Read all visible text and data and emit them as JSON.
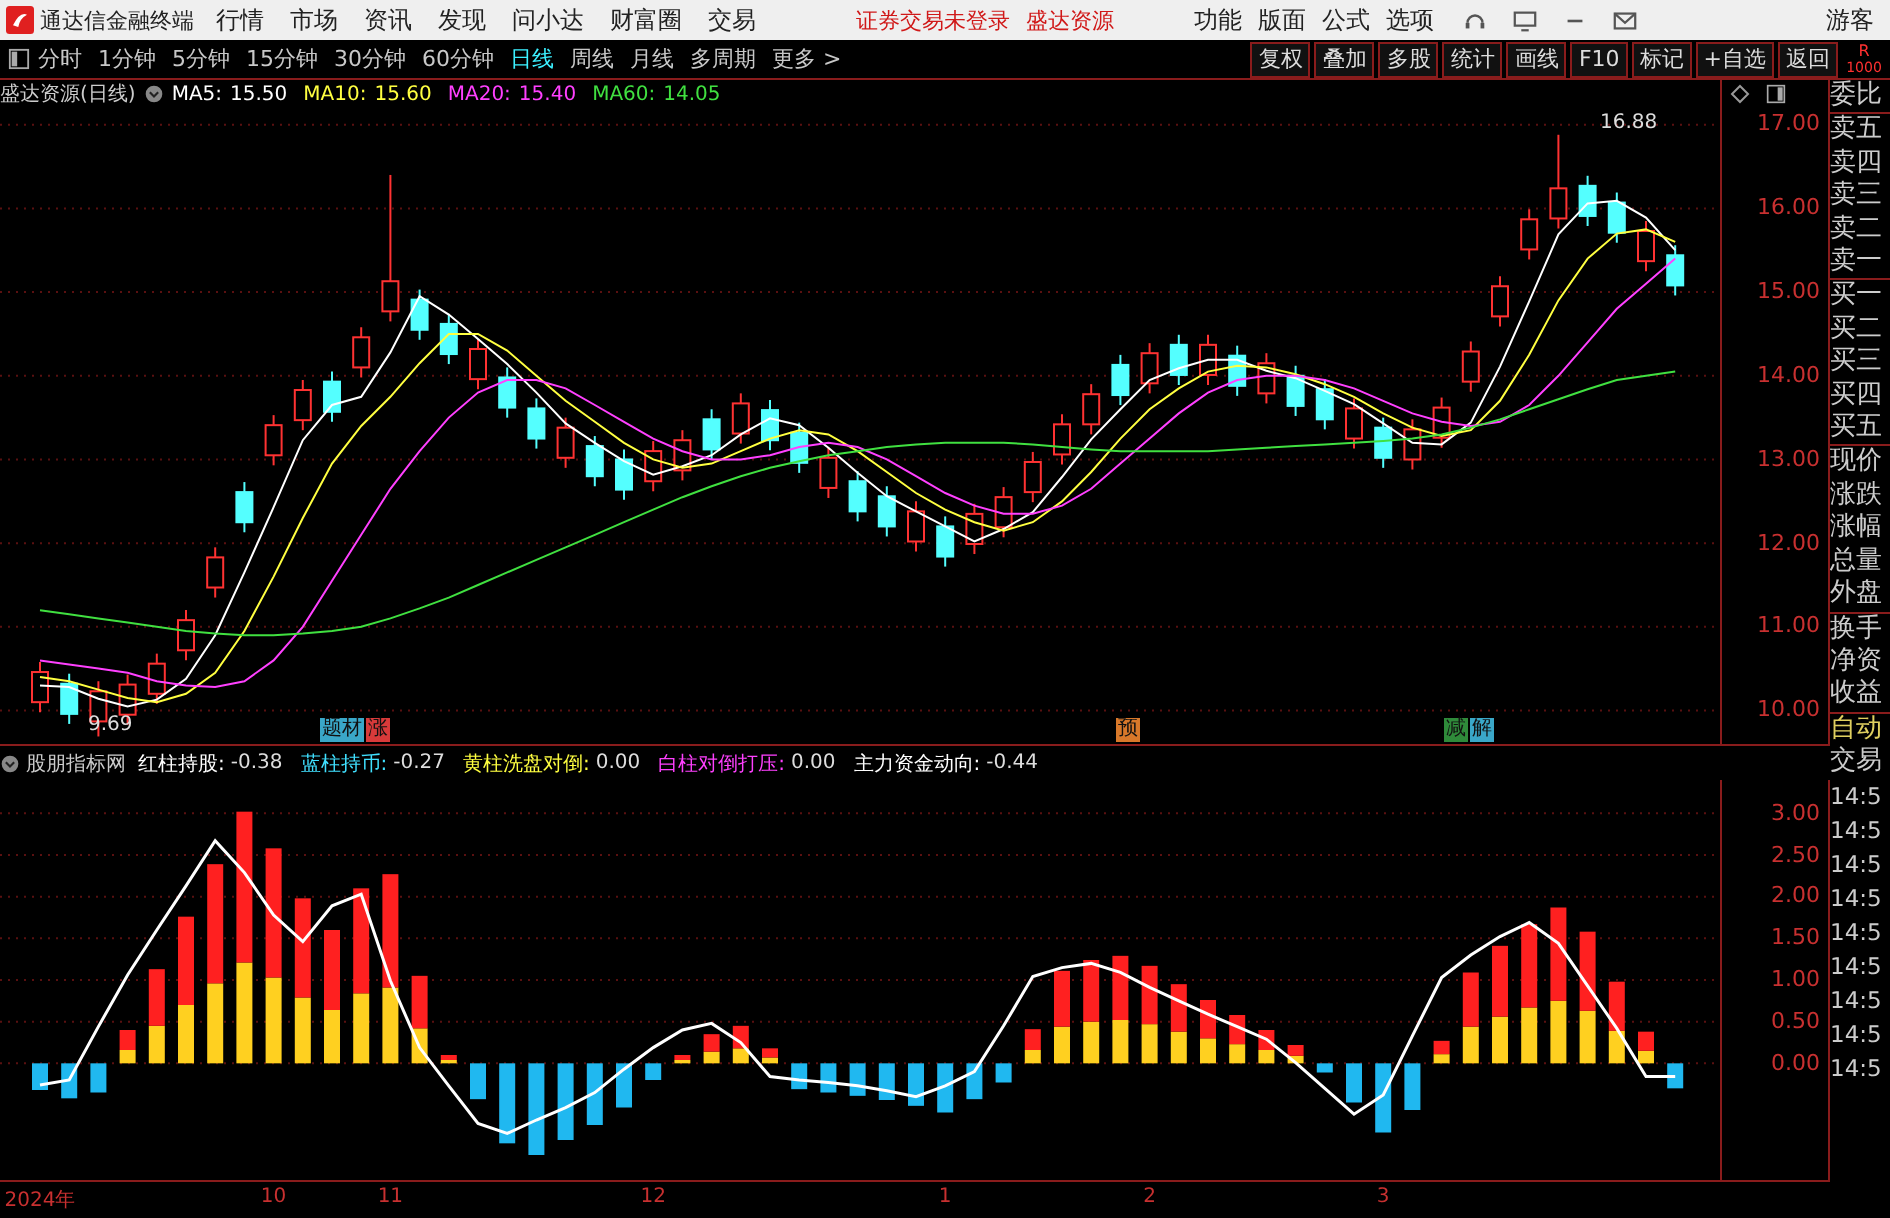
{
  "top_bar": {
    "app_title": "通达信金融终端",
    "menu": [
      "行情",
      "市场",
      "资讯",
      "发现",
      "问小达",
      "财富圈",
      "交易"
    ],
    "status": [
      "证券交易未登录",
      "盛达资源"
    ],
    "right_menu": [
      "功能",
      "版面",
      "公式",
      "选项"
    ],
    "user": "游客"
  },
  "toolbar": {
    "periods": [
      {
        "label": "分时",
        "selected": false
      },
      {
        "label": "1分钟",
        "selected": false
      },
      {
        "label": "5分钟",
        "selected": false
      },
      {
        "label": "15分钟",
        "selected": false
      },
      {
        "label": "30分钟",
        "selected": false
      },
      {
        "label": "60分钟",
        "selected": false
      },
      {
        "label": "日线",
        "selected": true
      },
      {
        "label": "周线",
        "selected": false
      },
      {
        "label": "月线",
        "selected": false
      },
      {
        "label": "多周期",
        "selected": false
      },
      {
        "label": "更多 >",
        "selected": false
      }
    ],
    "buttons": [
      "复权",
      "叠加",
      "多股",
      "统计",
      "画线",
      "F10",
      "标记",
      "+自选",
      "返回"
    ],
    "corner": [
      "R",
      "1000"
    ]
  },
  "price_chart": {
    "title": "盛达资源(日线)",
    "ma_values": [
      "15.50",
      "15.60",
      "15.40",
      "14.05"
    ],
    "chart_data": {
      "type": "candlestick",
      "grid": true,
      "ylim": [
        9.6,
        17.2
      ],
      "yticks": [
        {
          "value": 17,
          "label": "17.00"
        },
        {
          "value": 16,
          "label": "16.00"
        },
        {
          "value": 15,
          "label": "15.00"
        },
        {
          "value": 14,
          "label": "14.00"
        },
        {
          "value": 13,
          "label": "13.00"
        },
        {
          "value": 12,
          "label": "12.00"
        },
        {
          "value": 11,
          "label": "11.00"
        },
        {
          "value": 10,
          "label": "10.00"
        }
      ],
      "ohlc": [
        [
          10.1,
          10.58,
          9.98,
          10.46
        ],
        [
          10.32,
          10.44,
          9.84,
          9.96
        ],
        [
          9.87,
          10.35,
          9.69,
          10.23
        ],
        [
          9.95,
          10.43,
          9.83,
          10.31
        ],
        [
          10.2,
          10.68,
          10.08,
          10.56
        ],
        [
          10.72,
          11.2,
          10.6,
          11.08
        ],
        [
          11.47,
          11.95,
          11.35,
          11.83
        ],
        [
          12.61,
          12.73,
          12.13,
          12.25
        ],
        [
          13.05,
          13.53,
          12.93,
          13.41
        ],
        [
          13.47,
          13.95,
          13.35,
          13.83
        ],
        [
          13.93,
          14.05,
          13.45,
          13.57
        ],
        [
          14.1,
          14.58,
          13.98,
          14.46
        ],
        [
          14.77,
          16.4,
          14.65,
          15.13
        ],
        [
          14.91,
          15.03,
          14.43,
          14.55
        ],
        [
          14.62,
          14.74,
          14.14,
          14.26
        ],
        [
          13.96,
          14.44,
          13.84,
          14.32
        ],
        [
          13.98,
          14.1,
          13.5,
          13.62
        ],
        [
          13.61,
          13.73,
          13.13,
          13.25
        ],
        [
          13.02,
          13.5,
          12.9,
          13.38
        ],
        [
          13.16,
          13.28,
          12.68,
          12.8
        ],
        [
          13.0,
          13.12,
          12.52,
          12.64
        ],
        [
          12.74,
          13.22,
          12.62,
          13.1
        ],
        [
          12.87,
          13.35,
          12.75,
          13.23
        ],
        [
          13.48,
          13.6,
          13.0,
          13.12
        ],
        [
          13.31,
          13.79,
          13.19,
          13.67
        ],
        [
          13.59,
          13.71,
          13.11,
          13.23
        ],
        [
          13.32,
          13.44,
          12.84,
          12.96
        ],
        [
          12.66,
          13.14,
          12.54,
          13.02
        ],
        [
          12.74,
          12.86,
          12.26,
          12.38
        ],
        [
          12.56,
          12.68,
          12.08,
          12.2
        ],
        [
          12.02,
          12.5,
          11.9,
          12.38
        ],
        [
          12.2,
          12.32,
          11.72,
          11.84
        ],
        [
          11.99,
          12.47,
          11.87,
          12.35
        ],
        [
          12.19,
          12.67,
          12.07,
          12.55
        ],
        [
          12.61,
          13.09,
          12.49,
          12.97
        ],
        [
          13.06,
          13.54,
          12.94,
          13.42
        ],
        [
          13.42,
          13.9,
          13.3,
          13.78
        ],
        [
          14.13,
          14.25,
          13.65,
          13.77
        ],
        [
          13.91,
          14.39,
          13.79,
          14.27
        ],
        [
          14.37,
          14.49,
          13.89,
          14.01
        ],
        [
          14.01,
          14.49,
          13.89,
          14.37
        ],
        [
          14.24,
          14.36,
          13.76,
          13.88
        ],
        [
          13.79,
          14.27,
          13.67,
          14.15
        ],
        [
          14.0,
          14.12,
          13.52,
          13.64
        ],
        [
          13.84,
          13.96,
          13.36,
          13.48
        ],
        [
          13.25,
          13.73,
          13.13,
          13.61
        ],
        [
          13.38,
          13.5,
          12.9,
          13.02
        ],
        [
          13.0,
          13.48,
          12.88,
          13.36
        ],
        [
          13.26,
          13.74,
          13.14,
          13.62
        ],
        [
          13.93,
          14.41,
          13.81,
          14.29
        ],
        [
          14.71,
          15.19,
          14.59,
          15.07
        ],
        [
          15.51,
          15.99,
          15.39,
          15.87
        ],
        [
          15.88,
          16.88,
          15.76,
          16.24
        ],
        [
          16.27,
          16.39,
          15.79,
          15.91
        ],
        [
          16.07,
          16.19,
          15.59,
          15.71
        ],
        [
          15.37,
          15.85,
          15.25,
          15.73
        ],
        [
          15.44,
          15.56,
          14.96,
          15.08
        ]
      ],
      "series": [
        {
          "name": "MA5:",
          "type": "line",
          "color": "#ffffff",
          "values": [
            10.3,
            10.28,
            10.14,
            10.05,
            10.13,
            10.38,
            10.9,
            11.65,
            12.43,
            13.23,
            13.65,
            13.75,
            14.28,
            14.95,
            14.73,
            14.44,
            14.14,
            13.8,
            13.43,
            13.2,
            12.98,
            12.82,
            12.92,
            13.05,
            13.3,
            13.49,
            13.41,
            13.14,
            12.84,
            12.56,
            12.38,
            12.2,
            12.02,
            12.17,
            12.37,
            12.79,
            13.24,
            13.6,
            13.95,
            14.09,
            14.19,
            14.19,
            14.06,
            13.97,
            13.82,
            13.66,
            13.43,
            13.2,
            13.18,
            13.44,
            14.11,
            14.89,
            15.69,
            16.06,
            16.09,
            15.89,
            15.5
          ]
        },
        {
          "name": "MA10:",
          "type": "line",
          "color": "#ffff40",
          "values": [
            10.4,
            10.35,
            10.25,
            10.15,
            10.1,
            10.2,
            10.45,
            10.95,
            11.6,
            12.3,
            12.95,
            13.4,
            13.75,
            14.15,
            14.5,
            14.5,
            14.3,
            14.0,
            13.7,
            13.45,
            13.2,
            13.0,
            12.9,
            12.95,
            13.1,
            13.25,
            13.35,
            13.3,
            13.1,
            12.85,
            12.6,
            12.4,
            12.25,
            12.15,
            12.25,
            12.5,
            12.85,
            13.25,
            13.6,
            13.85,
            14.05,
            14.12,
            14.1,
            14.02,
            13.9,
            13.75,
            13.55,
            13.38,
            13.28,
            13.35,
            13.7,
            14.25,
            14.9,
            15.4,
            15.7,
            15.75,
            15.6
          ]
        },
        {
          "name": "MA20:",
          "type": "line",
          "color": "#ff40ff",
          "values": [
            10.6,
            10.55,
            10.5,
            10.45,
            10.35,
            10.3,
            10.28,
            10.35,
            10.6,
            11.0,
            11.55,
            12.1,
            12.65,
            13.1,
            13.5,
            13.8,
            13.95,
            13.95,
            13.85,
            13.65,
            13.45,
            13.25,
            13.1,
            13.0,
            13.0,
            13.05,
            13.15,
            13.2,
            13.15,
            13.0,
            12.8,
            12.6,
            12.45,
            12.35,
            12.35,
            12.45,
            12.65,
            12.95,
            13.25,
            13.55,
            13.8,
            13.95,
            14.0,
            14.0,
            13.95,
            13.85,
            13.7,
            13.55,
            13.45,
            13.4,
            13.45,
            13.65,
            14.0,
            14.4,
            14.8,
            15.1,
            15.4
          ]
        },
        {
          "name": "MA60:",
          "type": "line",
          "color": "#40e040",
          "values": [
            11.2,
            11.15,
            11.1,
            11.05,
            11.0,
            10.95,
            10.92,
            10.9,
            10.9,
            10.92,
            10.95,
            11.0,
            11.1,
            11.22,
            11.35,
            11.5,
            11.65,
            11.8,
            11.95,
            12.1,
            12.25,
            12.4,
            12.55,
            12.68,
            12.8,
            12.9,
            12.98,
            13.05,
            13.1,
            13.15,
            13.18,
            13.2,
            13.2,
            13.2,
            13.18,
            13.15,
            13.12,
            13.1,
            13.1,
            13.1,
            13.1,
            13.12,
            13.14,
            13.16,
            13.18,
            13.2,
            13.22,
            13.25,
            13.3,
            13.38,
            13.48,
            13.6,
            13.72,
            13.84,
            13.95,
            14.0,
            14.05
          ]
        }
      ]
    },
    "high_label": "16.88",
    "low_label": "9.69",
    "markers": [
      {
        "text": "题材",
        "color": "#3aa7c8"
      },
      {
        "text": "涨",
        "color": "#d83a3a"
      },
      {
        "text": "预",
        "color": "#d8782a"
      },
      {
        "text": "减",
        "color": "#2f8a3a"
      },
      {
        "text": "解",
        "color": "#3aa7c8"
      }
    ]
  },
  "indicator": {
    "name": "股朋指标网",
    "legend": [
      {
        "value": "-0.38",
        "color": "#ffffff"
      },
      {
        "value": "-0.27",
        "color": "#40e0ff"
      },
      {
        "value": "0.00",
        "color": "#ffff40"
      },
      {
        "label": "白柱对倒打压:",
        "value": "0.00",
        "color": "#ff40ff"
      },
      {
        "value": "-0.44",
        "color": "#ffffff"
      }
    ],
    "chart_data": {
      "type": "bar",
      "grid": true,
      "stacked": true,
      "ylim": [
        -1.4,
        3.4
      ],
      "categories": [
        "2024年",
        null,
        null,
        null,
        null,
        null,
        null,
        null,
        "10",
        null,
        null,
        null,
        "11",
        null,
        null,
        null,
        null,
        null,
        null,
        null,
        null,
        "12",
        null,
        null,
        null,
        null,
        null,
        null,
        null,
        null,
        null,
        "1",
        null,
        null,
        null,
        null,
        null,
        null,
        "2",
        null,
        null,
        null,
        null,
        null,
        null,
        null,
        "3",
        null,
        null,
        null,
        null,
        null,
        null,
        null,
        null,
        null,
        null
      ],
      "yticks": [
        {
          "value": 3,
          "label": "3.00"
        },
        {
          "value": 2.5,
          "label": "2.50"
        },
        {
          "value": 2,
          "label": "2.00"
        },
        {
          "value": 1.5,
          "label": "1.50"
        },
        {
          "value": 1,
          "label": "1.00"
        },
        {
          "value": 0.5,
          "label": "0.50"
        },
        {
          "value": 0,
          "label": "0.00"
        }
      ],
      "series": [
        {
          "name": "黄柱洗盘对倒:",
          "color": "#ffd020",
          "values": [
            null,
            null,
            null,
            0.16,
            0.45,
            0.7,
            0.96,
            1.21,
            1.03,
            0.79,
            0.64,
            0.84,
            0.91,
            0.42,
            0.04,
            null,
            null,
            null,
            null,
            null,
            null,
            null,
            0.04,
            0.14,
            0.18,
            0.07,
            null,
            null,
            null,
            null,
            null,
            null,
            null,
            null,
            0.16,
            0.44,
            0.5,
            0.52,
            0.47,
            0.38,
            0.3,
            0.23,
            0.16,
            0.09,
            null,
            null,
            null,
            null,
            0.11,
            0.44,
            0.56,
            0.67,
            0.75,
            0.63,
            0.39,
            0.15,
            null
          ]
        },
        {
          "name": "红柱持股:",
          "color": "#ff2020",
          "values": [
            null,
            null,
            null,
            0.24,
            0.68,
            1.06,
            1.43,
            1.81,
            1.55,
            1.19,
            0.96,
            1.26,
            1.36,
            0.63,
            0.06,
            null,
            null,
            null,
            null,
            null,
            null,
            null,
            0.06,
            0.21,
            0.27,
            0.11,
            null,
            null,
            null,
            null,
            null,
            null,
            null,
            null,
            0.25,
            0.67,
            0.74,
            0.77,
            0.7,
            0.57,
            0.46,
            0.35,
            0.24,
            0.13,
            null,
            null,
            null,
            null,
            0.16,
            0.65,
            0.85,
            1.0,
            1.12,
            0.95,
            0.59,
            0.23,
            null
          ]
        },
        {
          "name": "蓝柱持币:",
          "color": "#20b8f0",
          "values": [
            -0.32,
            -0.42,
            -0.35,
            null,
            null,
            null,
            null,
            null,
            null,
            null,
            null,
            null,
            null,
            null,
            null,
            -0.43,
            -0.96,
            -1.1,
            -0.92,
            -0.74,
            -0.53,
            -0.2,
            null,
            null,
            null,
            null,
            -0.31,
            -0.35,
            -0.39,
            -0.44,
            -0.51,
            -0.59,
            -0.43,
            -0.23,
            null,
            null,
            null,
            null,
            null,
            null,
            null,
            null,
            null,
            null,
            -0.11,
            -0.47,
            -0.83,
            -0.56,
            null,
            null,
            null,
            null,
            null,
            null,
            null,
            null,
            -0.3
          ]
        },
        {
          "name": "主力资金动向:",
          "type": "line",
          "color": "#ffffff",
          "values": [
            -0.26,
            -0.2,
            0.44,
            1.06,
            1.6,
            2.13,
            2.67,
            2.29,
            1.78,
            1.46,
            1.89,
            2.03,
            0.99,
            0.19,
            -0.27,
            -0.72,
            -0.84,
            -0.68,
            -0.53,
            -0.35,
            -0.07,
            0.19,
            0.4,
            0.48,
            0.25,
            -0.16,
            -0.2,
            -0.23,
            -0.27,
            -0.33,
            -0.4,
            -0.27,
            -0.1,
            0.45,
            1.04,
            1.15,
            1.2,
            1.09,
            0.91,
            0.75,
            0.59,
            0.44,
            0.29,
            0.01,
            -0.3,
            -0.61,
            -0.38,
            0.33,
            1.03,
            1.3,
            1.52,
            1.69,
            1.44,
            0.93,
            0.42,
            -0.16,
            -0.16
          ]
        }
      ]
    }
  },
  "side_panel": {
    "quote_groups": [
      [
        "委比"
      ],
      [
        "卖五",
        "卖四",
        "卖三",
        "卖二",
        "卖一"
      ],
      [
        "买一",
        "买二",
        "买三",
        "买四",
        "买五"
      ],
      [
        "现价",
        "涨跌",
        "涨幅",
        "总量",
        "外盘"
      ],
      [
        "换手",
        "净资",
        "收益"
      ]
    ],
    "trade_header": [
      "自动",
      "交易"
    ],
    "trades": [
      "14:5",
      "14:5",
      "14:5",
      "14:5",
      "14:5",
      "14:5",
      "14:5",
      "14:5",
      "14:5"
    ]
  }
}
